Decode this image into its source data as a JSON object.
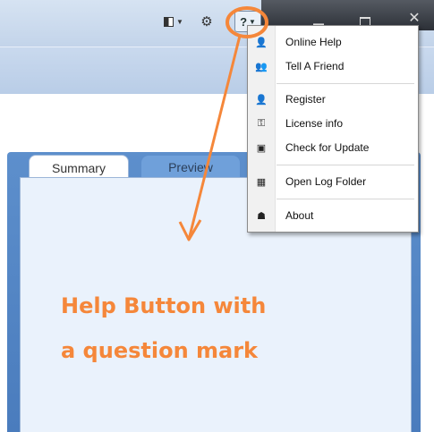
{
  "toolbar": {
    "layout_icon": "layout-panel-icon",
    "settings_icon": "gear-icon",
    "help_label": "?",
    "help_icon": "question-mark-icon"
  },
  "tabs": [
    {
      "label": "Summary"
    },
    {
      "label": "Preview"
    }
  ],
  "help_menu": {
    "items": [
      {
        "label": "Online Help",
        "icon": "help-person-icon"
      },
      {
        "label": "Tell A Friend",
        "icon": "people-icon"
      },
      {
        "label": "Register",
        "icon": "user-add-icon"
      },
      {
        "label": "License info",
        "icon": "key-icon"
      },
      {
        "label": "Check for Update",
        "icon": "update-box-icon"
      },
      {
        "label": "Open Log Folder",
        "icon": "log-grid-icon"
      },
      {
        "label": "About",
        "icon": "about-icon"
      }
    ]
  },
  "annotation": {
    "line1": "Help Button with",
    "line2": "a question mark",
    "color": "#f5873a"
  }
}
